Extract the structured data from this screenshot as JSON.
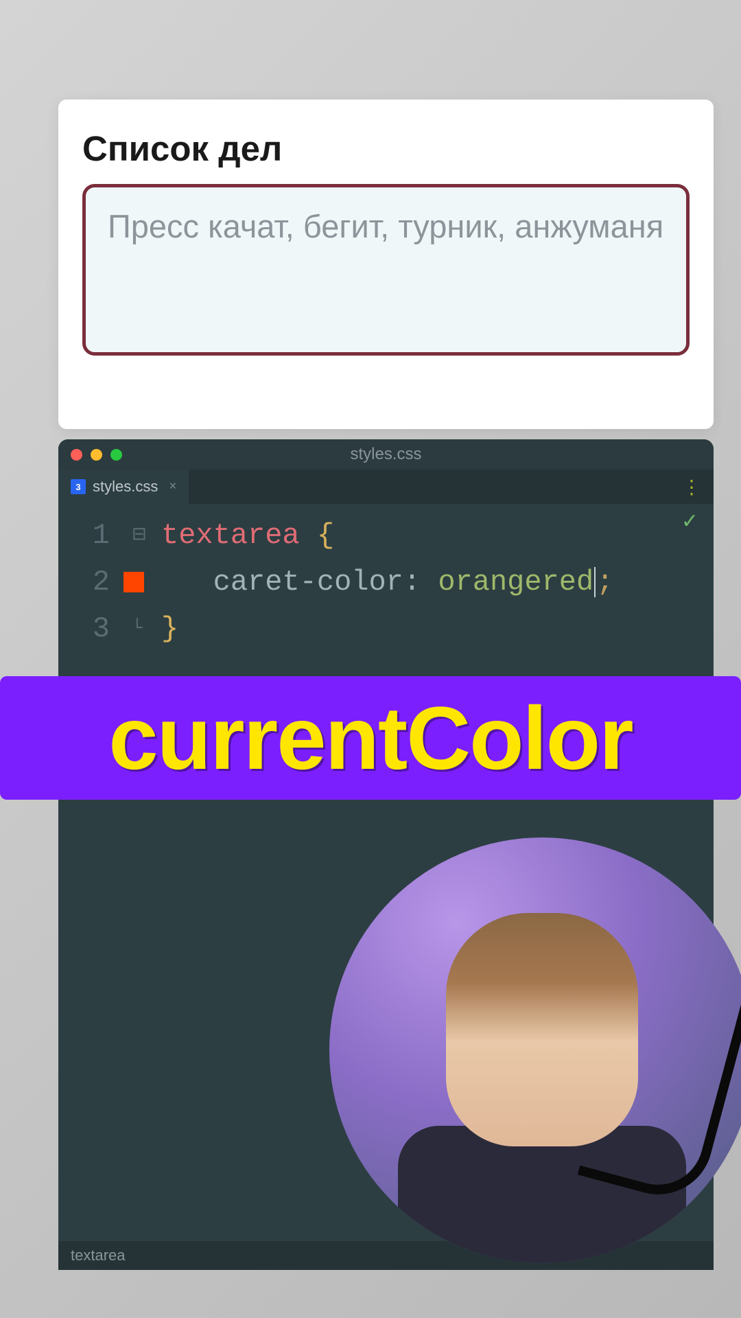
{
  "top_panel": {
    "title": "Список дел",
    "textarea_value": "Пресс качат, бегит, турник, анжуманя"
  },
  "editor": {
    "window_title": "styles.css",
    "tab": {
      "filename": "styles.css",
      "icon_label": "3"
    },
    "code": {
      "line_numbers": [
        "1",
        "2",
        "3"
      ],
      "selector": "textarea",
      "brace_open": "{",
      "property": "caret-color",
      "colon": ":",
      "value": "orangered",
      "semicolon": ";",
      "brace_close": "}",
      "swatch_color": "#ff4500"
    },
    "status_bar": "textarea"
  },
  "caption": {
    "text": "currentColor",
    "bg_color": "#7c1fff",
    "text_color": "#ffe600"
  }
}
